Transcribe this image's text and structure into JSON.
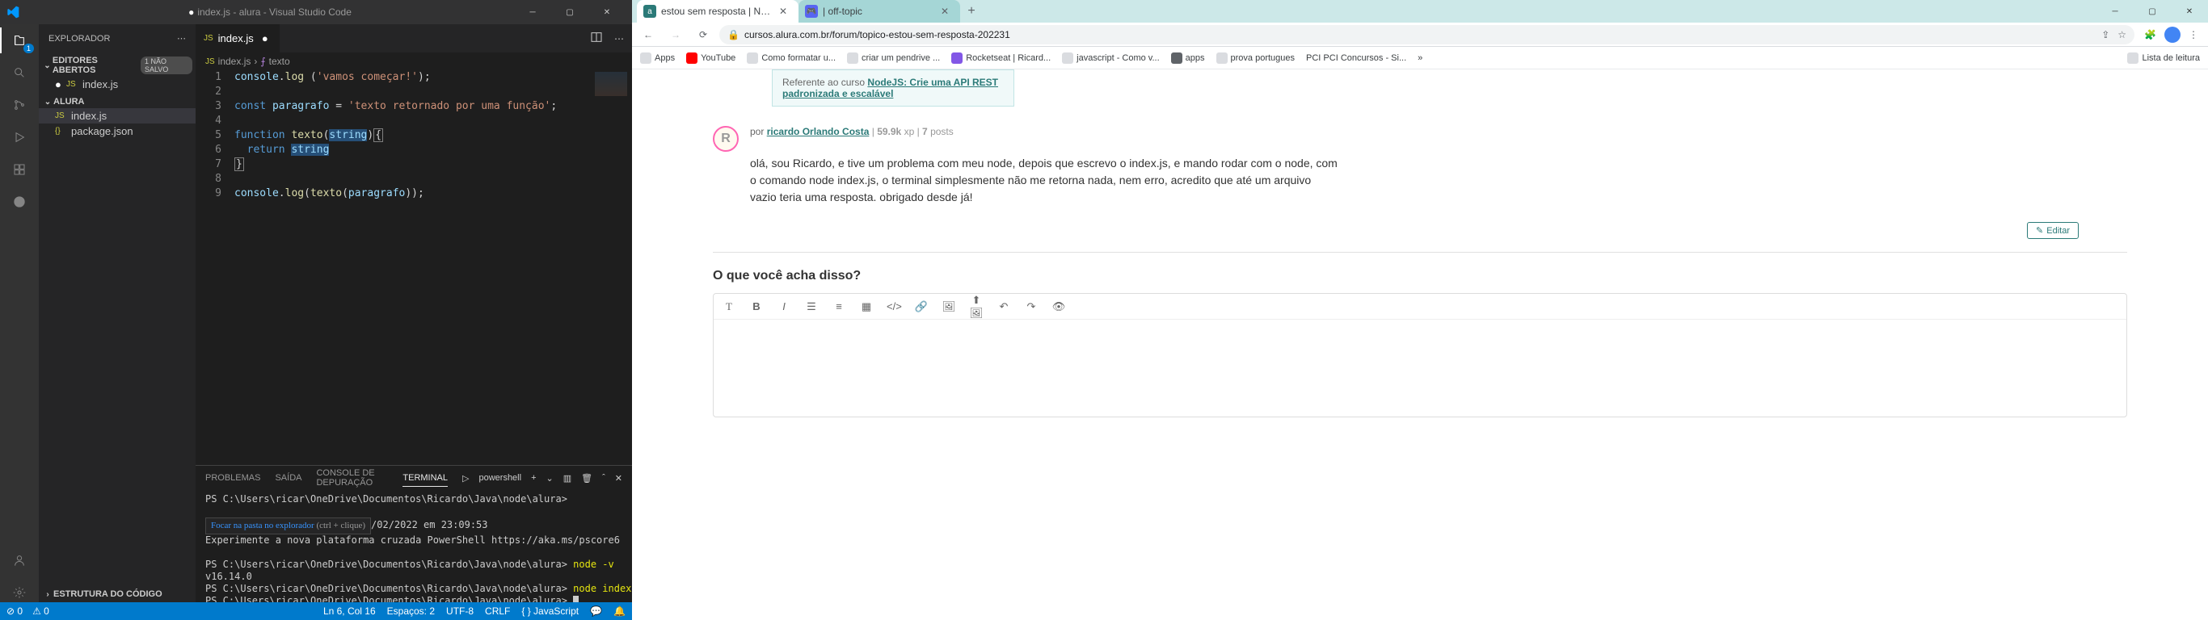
{
  "vscode": {
    "title": "index.js - alura - Visual Studio Code",
    "modified_dot": "●",
    "explorer": {
      "title": "EXPLORADOR",
      "open_editors": {
        "label": "EDITORES ABERTOS",
        "badge": "1 NÃO SALVO",
        "items": [
          {
            "name": "index.js",
            "modified": true
          }
        ]
      },
      "workspace": {
        "label": "ALURA",
        "items": [
          {
            "name": "index.js",
            "icon": "js",
            "selected": true
          },
          {
            "name": "package.json",
            "icon": "json"
          }
        ]
      },
      "outline": {
        "label": "ESTRUTURA DO CÓDIGO"
      }
    },
    "tabs": [
      {
        "name": "index.js",
        "modified": true
      }
    ],
    "breadcrumb": [
      {
        "icon": "js",
        "text": "index.js"
      },
      {
        "icon": "fn",
        "text": "texto"
      }
    ],
    "code": {
      "lines": [
        {
          "html": "<span class='var'>console</span>.<span class='fn'>log</span> (<span class='str'>'vamos começar!'</span>);"
        },
        {
          "html": ""
        },
        {
          "html": "<span class='kw'>const</span> <span class='var'>paragrafo</span> = <span class='str'>'texto retornado por uma função'</span>;"
        },
        {
          "html": ""
        },
        {
          "html": "<span class='kw'>function</span> <span class='fn'>texto</span>(<span class='var sel'>string</span>)<span class='box'>{</span>"
        },
        {
          "html": "  <span class='kw'>return</span> <span class='var sel'>string</span>"
        },
        {
          "html": "<span class='box'>}</span>"
        },
        {
          "html": ""
        },
        {
          "html": "<span class='var'>console</span>.<span class='fn'>log</span>(<span class='fn'>texto</span>(<span class='var'>paragrafo</span>));"
        }
      ]
    },
    "panel": {
      "tabs": [
        "PROBLEMAS",
        "SAÍDA",
        "CONSOLE DE DEPURAÇÃO",
        "TERMINAL"
      ],
      "active": 3,
      "shell": "powershell",
      "terminal_lines": [
        "PS C:\\Users\\ricar\\OneDrive\\Documentos\\Ricardo\\Java\\node\\alura>",
        "",
        "TOOLTIP",
        "Experimente a nova plataforma cruzada PowerShell https://aka.ms/pscore6",
        "",
        "PS C:\\Users\\ricar\\OneDrive\\Documentos\\Ricardo\\Java\\node\\alura> node -v",
        "v16.14.0",
        "PS C:\\Users\\ricar\\OneDrive\\Documentos\\Ricardo\\Java\\node\\alura> node index.js",
        "PS C:\\Users\\ricar\\OneDrive\\Documentos\\Ricardo\\Java\\node\\alura> CURSOR"
      ],
      "tooltip": "Focar na pasta no explorador",
      "tooltip_hint": "(ctrl + clique)",
      "tooltip_suffix": "/02/2022 em 23:09:53"
    },
    "status": {
      "left": [
        "⊘ 0",
        "⚠ 0"
      ],
      "right": [
        "Ln 6, Col 16",
        "Espaços: 2",
        "UTF-8",
        "CRLF",
        "{ } JavaScript"
      ]
    }
  },
  "chrome": {
    "tabs": [
      {
        "favicon_bg": "#2b7a78",
        "favicon_text": "a",
        "label": "estou sem resposta | NodeJS: Cr",
        "active": true
      },
      {
        "favicon_bg": "#5865F2",
        "favicon_text": "🎮",
        "label": "| off-topic",
        "active": false
      }
    ],
    "url": "cursos.alura.com.br/forum/topico-estou-sem-resposta-202231",
    "bookmarks": [
      "Apps",
      "YouTube",
      "Como formatar u...",
      "criar um pendrive ...",
      "Rocketseat | Ricard...",
      "javascript - Como v...",
      "apps",
      "prova portugues",
      "PCI  PCI Concursos - Si..."
    ],
    "bookmarks_right": "Lista de leitura",
    "content": {
      "course_ref_prefix": "Referente ao curso ",
      "course_ref_link": "NodeJS: Crie uma API REST padronizada e escalável",
      "avatar_letter": "R",
      "by": "por",
      "author": "ricardo Orlando Costa",
      "xp": "59.9k",
      "xp_label": "xp",
      "posts": "7",
      "posts_label": "posts",
      "body": "olá, sou Ricardo, e tive um problema com meu node, depois que escrevo o index.js, e mando rodar com o node, com o comando node index.js, o terminal simplesmente não me retorna nada, nem erro, acredito que até um arquivo vazio teria uma resposta. obrigado desde já!",
      "edit": "Editar",
      "reply_heading": "O que você acha disso?"
    }
  }
}
